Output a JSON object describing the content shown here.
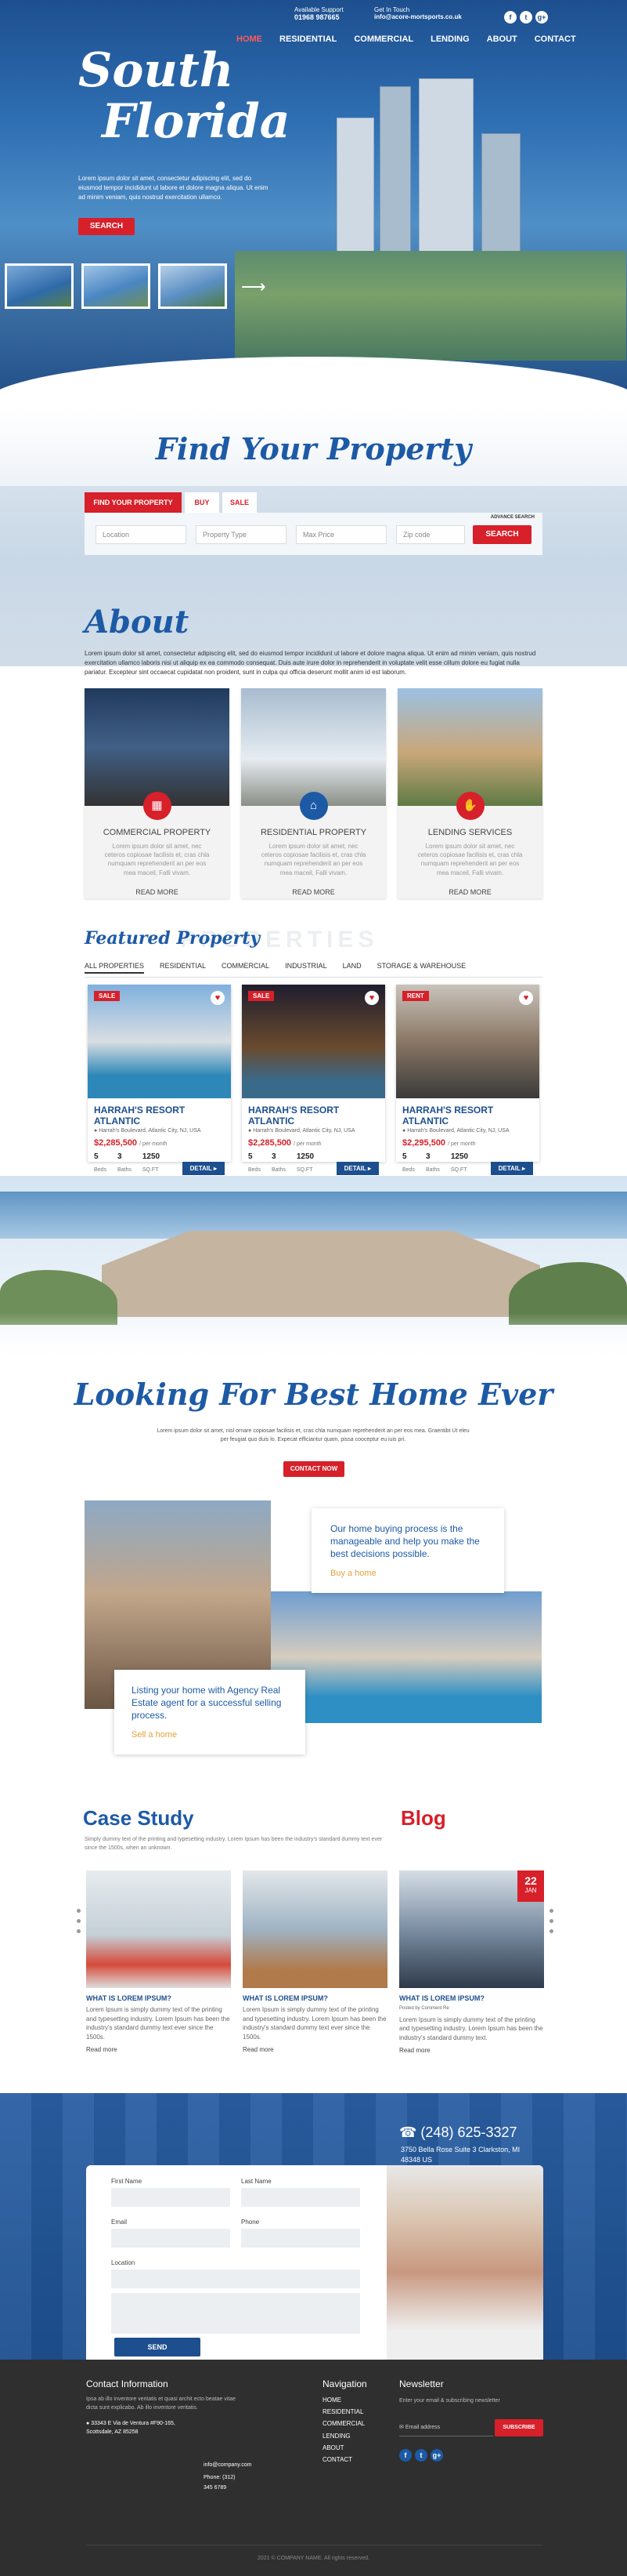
{
  "topbar": {
    "support_label": "Available Support",
    "support_phone": "01968 987665",
    "mail_label": "Get In Touch",
    "mail_value": "info@acore-mortsports.co.uk",
    "nav": [
      "HOME",
      "RESIDENTIAL",
      "COMMERCIAL",
      "LENDING",
      "ABOUT",
      "CONTACT"
    ],
    "social": [
      "f",
      "t",
      "g+"
    ]
  },
  "hero": {
    "title_line1": "South",
    "title_line2": "Florida",
    "text": "Lorem ipsum dolor sit amet, consectetur adipiscing elit, sed do eiusmod tempor incididunt ut labore et dolore magna aliqua. Ut enim ad minim veniam, quis nostrud exercitation ullamco.",
    "button": "SEARCH"
  },
  "find": {
    "title": "Find Your Property",
    "tabs": [
      "FIND YOUR PROPERTY",
      "BUY",
      "SALE"
    ],
    "advance": "ADVANCE SEARCH",
    "fields": [
      "Location",
      "Property Type",
      "Max Price",
      "Zip code"
    ],
    "button": "SEARCH"
  },
  "about": {
    "title": "About",
    "text": "Lorem ipsum dolor sit amet, consectetur adipiscing elit, sed do eiusmod tempor incididunt ut labore et dolore magna aliqua. Ut enim ad minim veniam, quis nostrud exercitation ullamco laboris nisi ut aliquip ex ea commodo consequat. Duis aute irure dolor in reprehenderit in voluptate velit esse cillum dolore eu fugiat nulla pariatur. Excepteur sint occaecat cupidatat non proident, sunt in culpa qui officia deserunt mollit anim id est laborum.",
    "cards": [
      {
        "title": "COMMERCIAL PROPERTY",
        "text": "Lorem ipsum dolor sit amet, nec ceteros copiosae facilisis et, cras chla numquam reprehenderit an per eos mea maceil, Falli vivam.",
        "more": "READ MORE",
        "icon": "briefcase-icon"
      },
      {
        "title": "RESIDENTIAL PROPERTY",
        "text": "Lorem ipsum dolor sit amet, nec ceteros copiosae facilisis et, cras chla numquam reprehenderit an per eos mea maceil, Falli vivam.",
        "more": "READ MORE",
        "icon": "house-icon"
      },
      {
        "title": "LENDING SERVICES",
        "text": "Lorem ipsum dolor sit amet, nec ceteros copiosae facilisis et, cras chla numquam reprehenderit an per eos mea maceil, Falli vivam.",
        "more": "READ MORE",
        "icon": "hand-icon"
      }
    ]
  },
  "featured": {
    "title": "Featured Property",
    "watermark": "PROPERTIES",
    "tabs": [
      "ALL PROPERTIES",
      "RESIDENTIAL",
      "COMMERCIAL",
      "INDUSTRIAL",
      "LAND",
      "STORAGE & WAREHOUSE"
    ],
    "cards": [
      {
        "badge": "SALE",
        "name": "HARRAH'S RESORT ATLANTIC",
        "addr": "Harrah's Boulevard, Atlantic City, NJ, USA",
        "price": "$2,285,500",
        "per": "/ per month",
        "beds": "5",
        "baths": "3",
        "sqft": "1250",
        "detail": "DETAIL"
      },
      {
        "badge": "SALE",
        "name": "HARRAH'S RESORT ATLANTIC",
        "addr": "Harrah's Boulevard, Atlantic City, NJ, USA",
        "price": "$2,285,500",
        "per": "/ per month",
        "beds": "5",
        "baths": "3",
        "sqft": "1250",
        "detail": "DETAIL"
      },
      {
        "badge": "RENT",
        "name": "HARRAH'S RESORT ATLANTIC",
        "addr": "Harrah's Boulevard, Atlantic City, NJ, USA",
        "price": "$2,295,500",
        "per": "/ per month",
        "beds": "5",
        "baths": "3",
        "sqft": "1250",
        "detail": "DETAIL"
      }
    ],
    "labels": {
      "beds": "Beds",
      "baths": "Baths",
      "sqft": "SQ.FT"
    }
  },
  "best": {
    "title": "Looking For Best Home Ever",
    "text": "Lorem ipsum dolor sit amet, nisl ornare copiosae facilisis et, cras chla numquam reprehenderit an per eos mea. Graentibt Ut eleu per feugiat quo duis lo. Expecat efficiantur quam, pissa cooceptur eu iuis pri.",
    "button": "CONTACT NOW",
    "box1": "Our home buying process is the manageable and help you make the best decisions possible.",
    "box1_link": "Buy a home",
    "box2": "Listing your home with Agency Real Estate agent for a successful selling process.",
    "box2_link": "Sell a home"
  },
  "case": {
    "title": "Case Study",
    "blog": "Blog",
    "text": "Simply dummy text of the printing and typesetting industry. Lorem Ipsum has been the industry's standard dummy text ever since the 1500s, when an unknown.",
    "items": [
      {
        "h": "WHAT IS LOREM IPSUM?",
        "p": "Lorem Ipsum is simply dummy text of the printing and typesetting industry. Lorem Ipsum has been the industry's standard dummy text ever since the 1500s.",
        "more": "Read more"
      },
      {
        "h": "WHAT IS LOREM IPSUM?",
        "p": "Lorem Ipsum is simply dummy text of the printing and typesetting industry. Lorem Ipsum has been the industry's standard dummy text ever since the 1500s.",
        "more": "Read more"
      }
    ],
    "blog_item": {
      "h": "WHAT IS LOREM IPSUM?",
      "meta": "Posted by   Comment   Re",
      "p": "Lorem Ipsum is simply dummy text of the printing and typesetting industry. Lorem Ipsum has been the industry's standard dummy text.",
      "more": "Read more",
      "day": "22",
      "month": "JAN"
    }
  },
  "contact": {
    "phone": "(248) 625-3327",
    "addr": "3750 Bella Rose Suite 3 Clarkston, MI 48348 US",
    "first": "First Name",
    "last": "Last Name",
    "email": "Email",
    "phone_label": "Phone",
    "location": "Location",
    "send": "SEND"
  },
  "footer": {
    "info_title": "Contact Information",
    "info_text": "Ipsa ab illo inventore veritatis et quasi archit ecto beatae vitae dicta sunt explicabo. Ab illo inventore veritatis.",
    "address": "33343 E Via de Ventura #F90-165, Scottsdale, AZ 85258",
    "email": "info@company.com",
    "phone": "Phone: (312) 345 6789",
    "nav_title": "Navigation",
    "nav": [
      "HOME",
      "RESIDENTIAL",
      "COMMERCIAL",
      "LENDING",
      "ABOUT",
      "CONTACT"
    ],
    "news_title": "Newsletter",
    "news_text": "Enter your email & subscribing newsletter",
    "news_placeholder": "Email address",
    "subscribe": "SUBSCRIBE",
    "copyright": "2021 © COMPANY NAME. All rights reserved."
  }
}
